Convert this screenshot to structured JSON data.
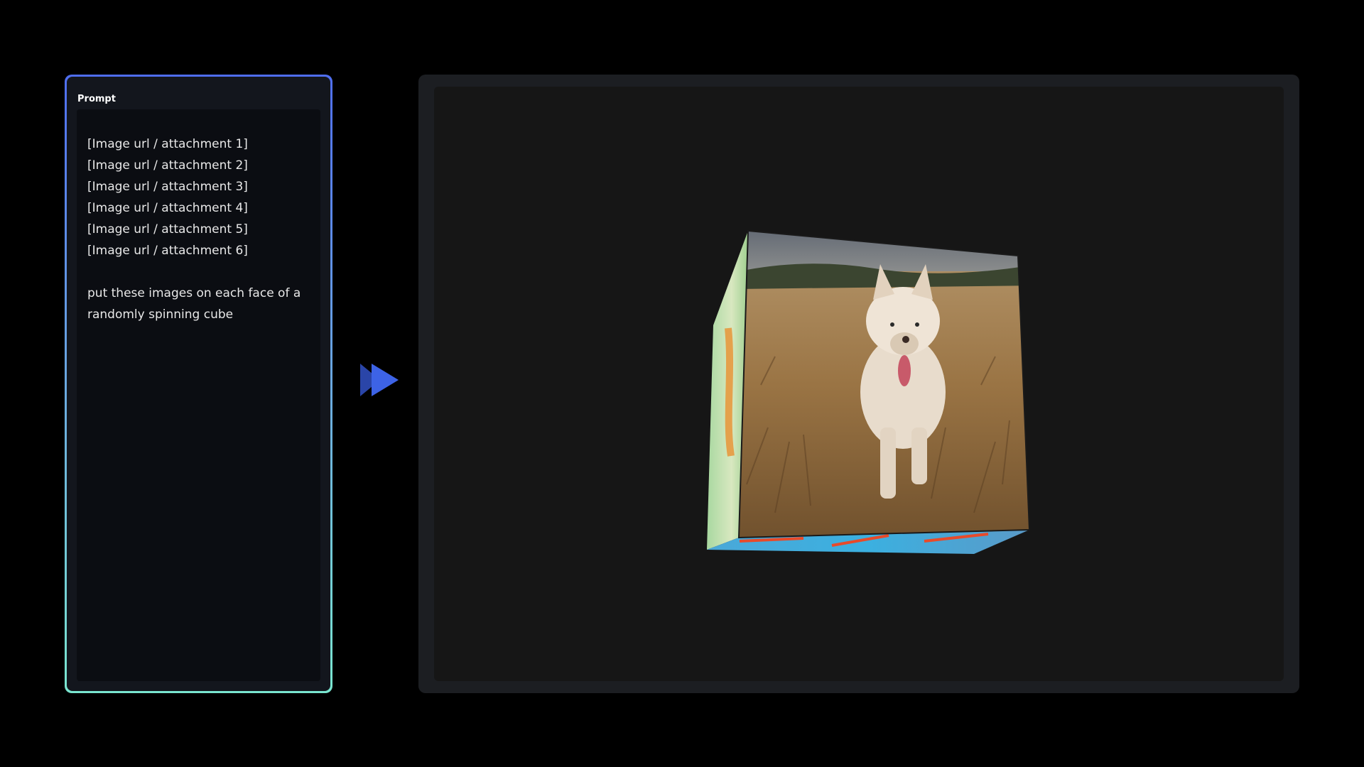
{
  "prompt": {
    "label": "Prompt",
    "lines": [
      "[Image url / attachment 1]",
      "[Image url / attachment 2]",
      "[Image url / attachment 3]",
      "[Image url / attachment 4]",
      "[Image url / attachment 5]",
      "[Image url / attachment 6]"
    ],
    "instruction_lines": [
      "put these images on each face of a",
      "randomly spinning cube"
    ]
  },
  "arrow": {
    "icon": "play-arrow-icon",
    "color_front": "#3d63e6",
    "color_back": "#2a45a8"
  },
  "preview": {
    "cube_front_image": "husky dog walking through a wheat field",
    "cube_side_image": "colorful illustration",
    "cube_bottom_image": "colorful illustration"
  },
  "colors": {
    "border_top": "#4f6ef0",
    "border_bottom": "#7ae6d0",
    "preview_bg": "#1c1e22",
    "canvas_bg": "#161616"
  }
}
